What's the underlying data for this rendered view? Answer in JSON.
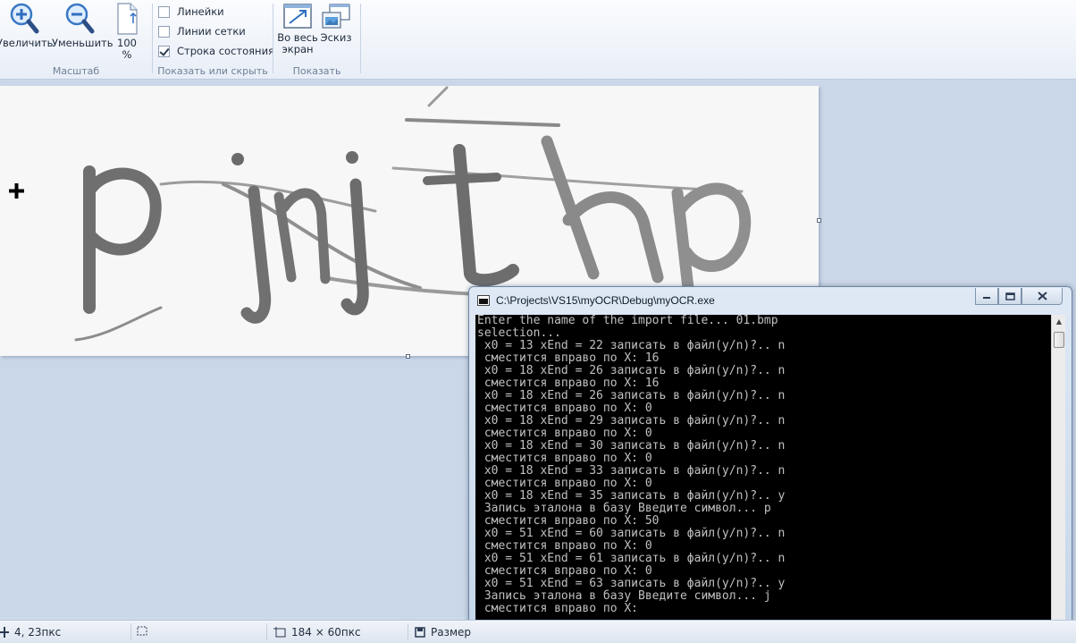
{
  "ribbon": {
    "zoom_group": {
      "label": "Масштаб",
      "zoom_in_label": "Увеличить",
      "zoom_out_label": "Уменьшить",
      "actual_size_line1": "100",
      "actual_size_line2": "%"
    },
    "show_hide_group": {
      "label": "Показать или скрыть",
      "rulers": {
        "label": "Линейки",
        "checked": false
      },
      "gridlines": {
        "label": "Линии сетки",
        "checked": false
      },
      "statusbar": {
        "label": "Строка состояния",
        "checked": true
      }
    },
    "display_group": {
      "label": "Показать",
      "fullscreen_line1": "Во весь",
      "fullscreen_line2": "экран",
      "thumbnail_label": "Эскиз"
    }
  },
  "console": {
    "title": "C:\\Projects\\VS15\\myOCR\\Debug\\myOCR.exe",
    "lines": [
      "Enter the name of the import file... 01.bmp",
      "selection...",
      " x0 = 13 xEnd = 22 записать в файл(y/n)?.. n",
      " сместится вправо по X: 16",
      " x0 = 18 xEnd = 26 записать в файл(y/n)?.. n",
      " сместится вправо по X: 16",
      " x0 = 18 xEnd = 26 записать в файл(y/n)?.. n",
      " сместится вправо по X: 0",
      " x0 = 18 xEnd = 29 записать в файл(y/n)?.. n",
      " сместится вправо по X: 0",
      " x0 = 18 xEnd = 30 записать в файл(y/n)?.. n",
      " сместится вправо по X: 0",
      " x0 = 18 xEnd = 33 записать в файл(y/n)?.. n",
      " сместится вправо по X: 0",
      " x0 = 18 xEnd = 35 записать в файл(y/n)?.. y",
      " Запись эталона в базу Введите символ... p",
      " сместится вправо по X: 50",
      " x0 = 51 xEnd = 60 записать в файл(y/n)?.. n",
      " сместится вправо по X: 0",
      " x0 = 51 xEnd = 61 записать в файл(y/n)?.. n",
      " сместится вправо по X: 0",
      " x0 = 51 xEnd = 63 записать в файл(y/n)?.. y",
      " Запись эталона в базу Введите символ... j",
      " сместится вправо по X:"
    ]
  },
  "statusbar": {
    "cursor_position": "4, 23пкс",
    "selection_size": "",
    "image_size": "184 × 60пкс",
    "file_size_label": "Размер"
  },
  "colors": {
    "ribbon_bg": "#e8eef7",
    "workspace_bg": "#cad7e8",
    "console_bg": "#000000",
    "console_text": "#c0c0c0"
  }
}
